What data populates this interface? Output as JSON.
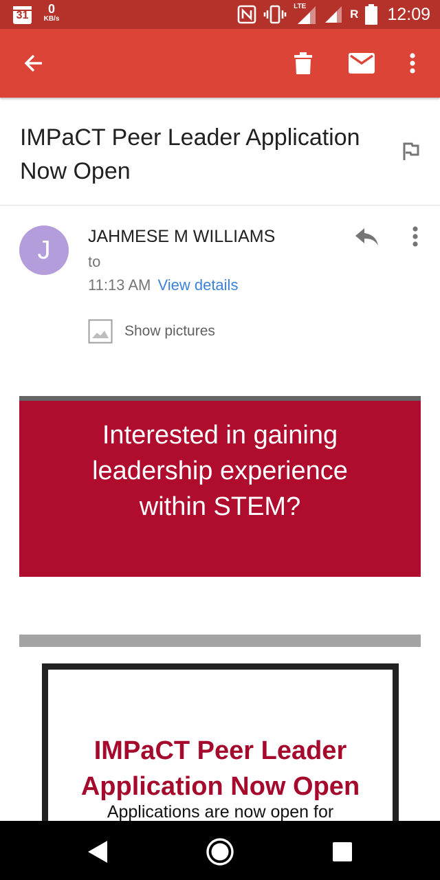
{
  "status_bar": {
    "calendar_day": "31",
    "data_speed_value": "0",
    "data_speed_unit": "KB/s",
    "network_type": "LTE",
    "roaming": "R",
    "time": "12:09",
    "icons": [
      "calendar-icon",
      "nfc-icon",
      "vibrate-icon",
      "signal-lte-icon",
      "signal-icon",
      "battery-icon"
    ]
  },
  "app_bar": {
    "background_color": "#db4437",
    "icons": [
      "back-arrow-icon",
      "delete-icon",
      "mark-unread-icon",
      "more-vert-icon"
    ]
  },
  "email": {
    "subject": "IMPaCT Peer Leader Application Now Open",
    "sender_initial": "J",
    "sender_name": "JAHMESE M WILLIAMS",
    "recipient_prefix": "to",
    "time": "11:13 AM",
    "view_details_label": "View details",
    "show_pictures_label": "Show pictures",
    "avatar_color": "#b39ddb",
    "link_color": "#3b82d8"
  },
  "body": {
    "banner_text": "Interested in gaining leadership experience within STEM?",
    "banner_color": "#af0c2e",
    "card_title": "IMPaCT Peer Leader Application Now Open",
    "card_text": "Applications are now open for",
    "card_title_color": "#a50a2d"
  },
  "nav_bar": {
    "icons": [
      "nav-back-icon",
      "nav-home-icon",
      "nav-recents-icon"
    ]
  }
}
